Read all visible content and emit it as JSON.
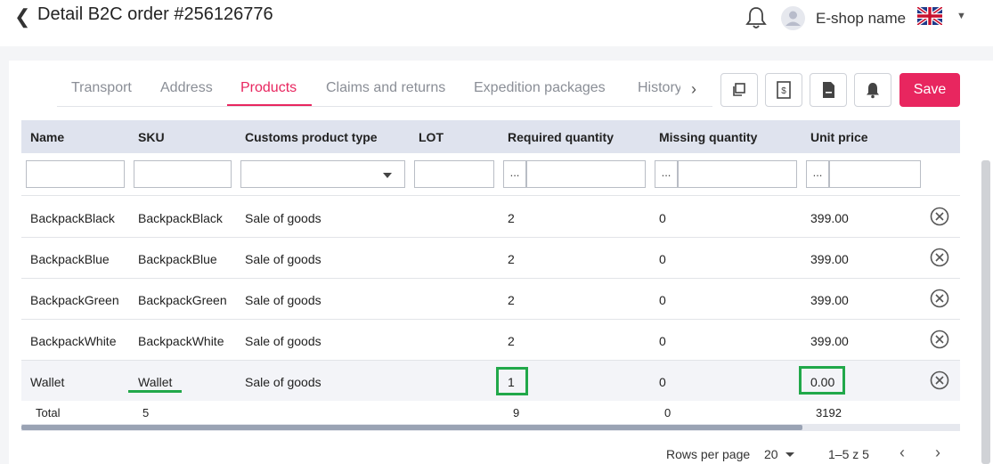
{
  "header": {
    "title": "Detail B2C order #256126776",
    "shop_name": "E-shop name",
    "icons": [
      "back-icon",
      "bell-icon",
      "user-avatar-icon",
      "uk-flag-icon",
      "chevron-down-icon"
    ]
  },
  "tabs": [
    {
      "label": "Transport",
      "active": false
    },
    {
      "label": "Address",
      "active": false
    },
    {
      "label": "Products",
      "active": true
    },
    {
      "label": "Claims and returns",
      "active": false
    },
    {
      "label": "Expedition packages",
      "active": false
    },
    {
      "label": "History",
      "active": false
    }
  ],
  "toolbar": {
    "icons": [
      "copy-icon",
      "invoice-icon",
      "document-icon",
      "bell-icon",
      "chevron-right-icon"
    ],
    "save_label": "Save"
  },
  "table": {
    "columns": [
      "Name",
      "SKU",
      "Customs product type",
      "LOT",
      "Required quantity",
      "Missing quantity",
      "Unit price"
    ],
    "filter_dots": "...",
    "rows": [
      {
        "name": "BackpackBlack",
        "sku": "BackpackBlack",
        "type": "Sale of goods",
        "lot": "",
        "required": "2",
        "missing": "0",
        "price": "399.00"
      },
      {
        "name": "BackpackBlue",
        "sku": "BackpackBlue",
        "type": "Sale of goods",
        "lot": "",
        "required": "2",
        "missing": "0",
        "price": "399.00"
      },
      {
        "name": "BackpackGreen",
        "sku": "BackpackGreen",
        "type": "Sale of goods",
        "lot": "",
        "required": "2",
        "missing": "0",
        "price": "399.00"
      },
      {
        "name": "BackpackWhite",
        "sku": "BackpackWhite",
        "type": "Sale of goods",
        "lot": "",
        "required": "2",
        "missing": "0",
        "price": "399.00"
      },
      {
        "name": "Wallet",
        "sku": "Wallet",
        "type": "Sale of goods",
        "lot": "",
        "required": "1",
        "missing": "0",
        "price": "0.00"
      }
    ],
    "totals": {
      "label": "Total",
      "sku_count": "5",
      "required": "9",
      "missing": "0",
      "price": "3192"
    }
  },
  "pagination": {
    "rows_per_page_label": "Rows per page",
    "rows_per_page": "20",
    "range": "1–5 z 5"
  },
  "colors": {
    "accent": "#e8265f",
    "highlight": "#21a84a",
    "header_bg": "#dfe3ee"
  }
}
